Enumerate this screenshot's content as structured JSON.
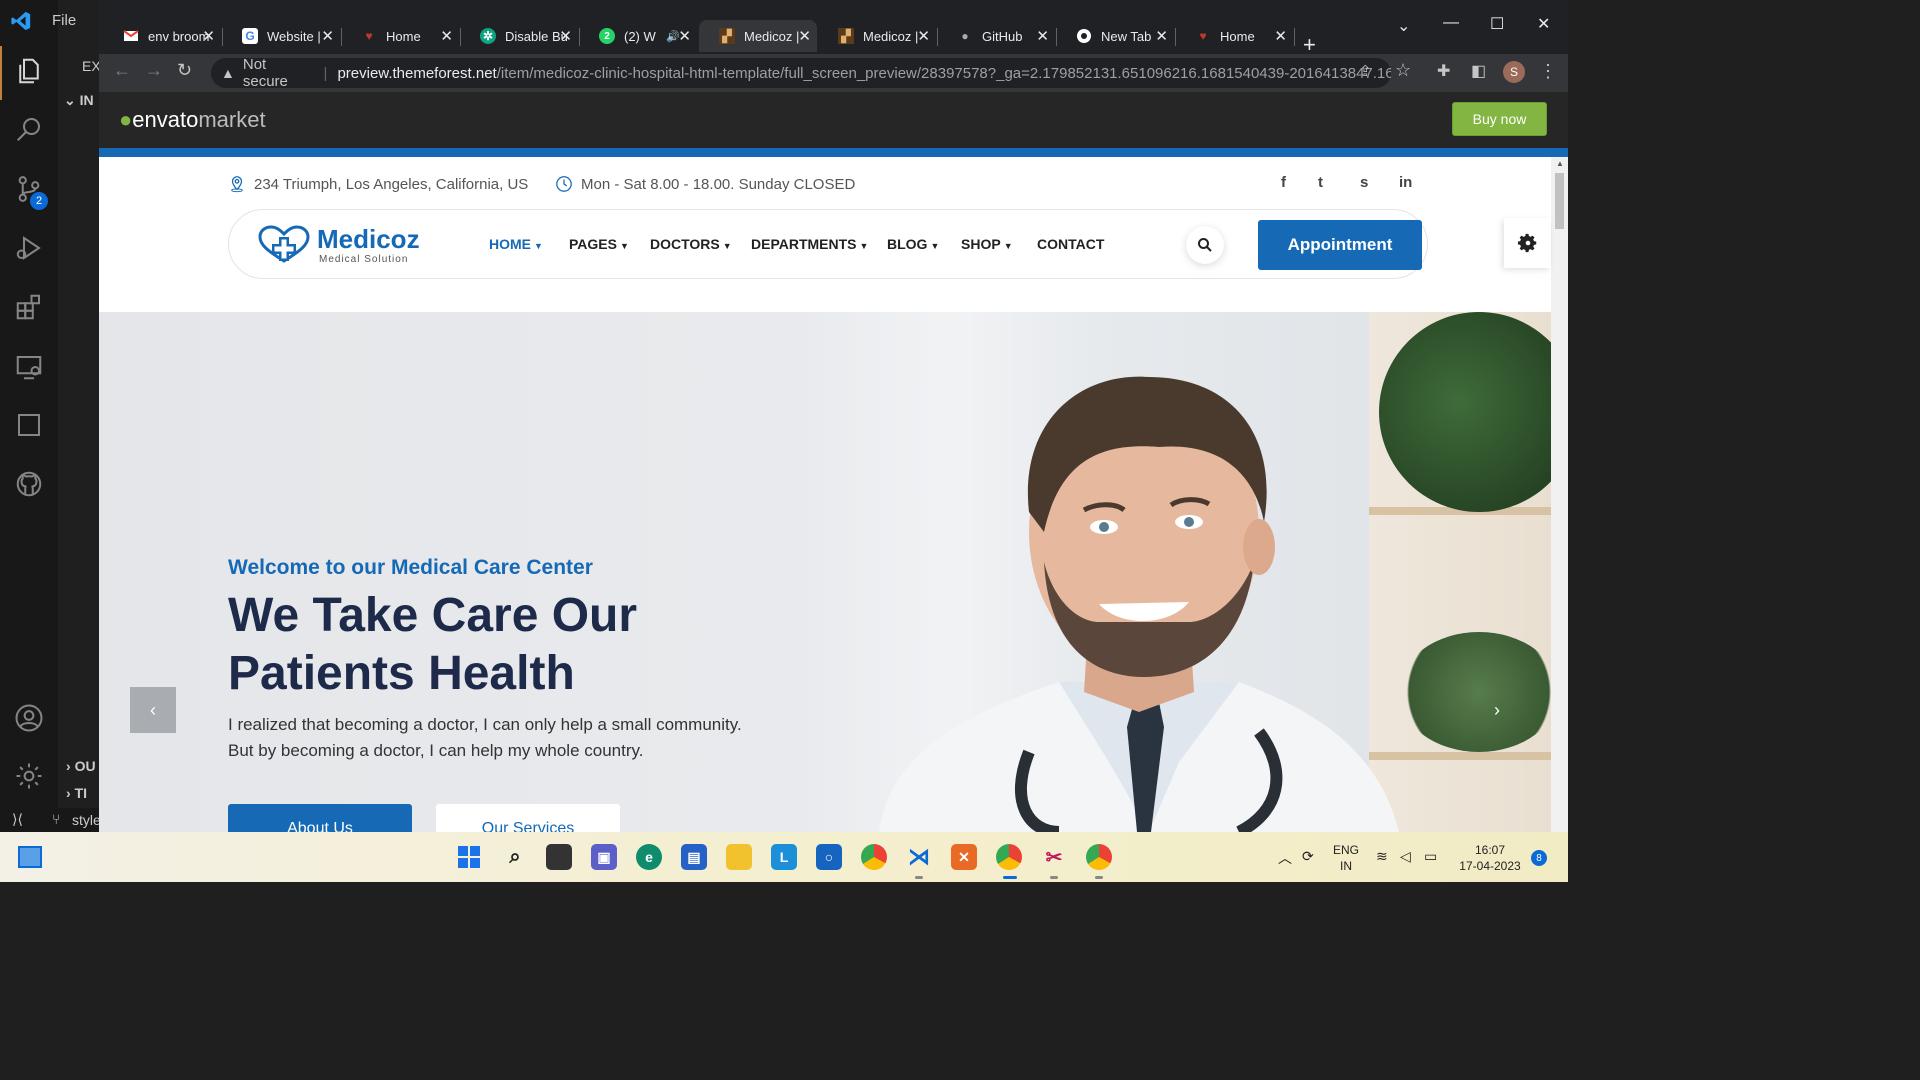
{
  "vscode": {
    "menu_file": "File",
    "side_explorer_short": "EX",
    "side_section_short": "IN",
    "side_outline_short": "OU",
    "side_timeline_short": "TI",
    "status_branch": "style",
    "scm_badge": "2"
  },
  "chrome": {
    "tabs": [
      {
        "title": "env broom",
        "favicon": "gmail-icon"
      },
      {
        "title": "Website |",
        "favicon": "google-icon"
      },
      {
        "title": "Home",
        "favicon": "medical-icon"
      },
      {
        "title": "Disable Bu",
        "favicon": "chatgpt-icon"
      },
      {
        "title": "(2) W",
        "favicon": "whatsapp-icon"
      },
      {
        "title": "Medicoz |",
        "favicon": "envato-icon"
      },
      {
        "title": "Medicoz |",
        "favicon": "envato-icon"
      },
      {
        "title": "GitHub",
        "favicon": "github-icon"
      },
      {
        "title": "New Tab",
        "favicon": "chrome-icon"
      },
      {
        "title": "Home",
        "favicon": "medical-icon"
      }
    ],
    "whatsapp_badge": "2",
    "active_tab_index": 5,
    "security_label": "Not secure",
    "url_host": "preview.themeforest.net",
    "url_path": "/item/medicoz-clinic-hospital-html-template/full_screen_preview/28397578?_ga=2.179852131.651096216.1681540439-2016413847.168...",
    "profile_initial": "S"
  },
  "envato": {
    "logo_envato": "envato",
    "logo_market": "market",
    "buy_label": "Buy now"
  },
  "site": {
    "address": "234 Triumph, Los Angeles, California, US",
    "hours": "Mon - Sat 8.00 - 18.00. Sunday CLOSED",
    "social": [
      "f",
      "t",
      "s",
      "in"
    ],
    "logo_name": "Medicoz",
    "logo_tagline": "Medical Solution",
    "nav": [
      {
        "label": "HOME",
        "dropdown": true,
        "active": true
      },
      {
        "label": "PAGES",
        "dropdown": true
      },
      {
        "label": "DOCTORS",
        "dropdown": true
      },
      {
        "label": "DEPARTMENTS",
        "dropdown": true
      },
      {
        "label": "BLOG",
        "dropdown": true
      },
      {
        "label": "SHOP",
        "dropdown": true
      },
      {
        "label": "CONTACT",
        "dropdown": false
      }
    ],
    "appointment_label": "Appointment",
    "hero": {
      "subtitle": "Welcome to our Medical Care Center",
      "title_line1": "We Take Care Our",
      "title_line2": "Patients Health",
      "desc_line1": "I realized that becoming a doctor, I can only help a small community.",
      "desc_line2": "But by becoming a doctor, I can help my whole country.",
      "btn_primary": "About Us",
      "btn_secondary": "Our Services"
    },
    "colors": {
      "brand": "#1569b5",
      "heading": "#1e2a4a",
      "envato_green": "#82b541"
    }
  },
  "taskbar": {
    "lang_line1": "ENG",
    "lang_line2": "IN",
    "time": "16:07",
    "date": "17-04-2023",
    "notification_count": "8"
  }
}
